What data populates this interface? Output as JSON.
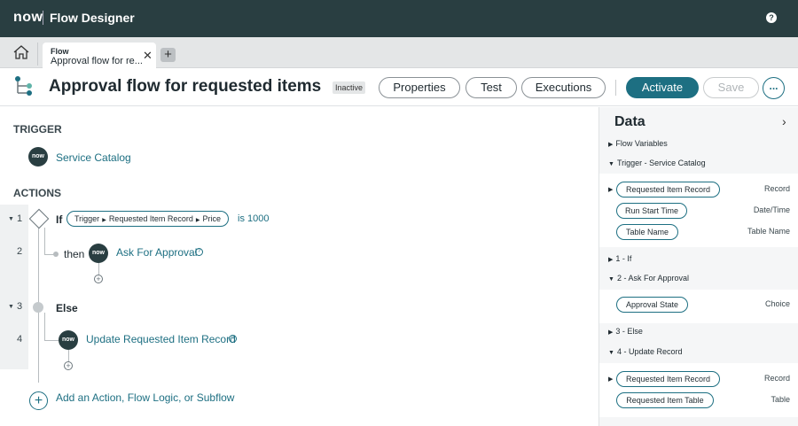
{
  "topbar": {
    "logo": "now",
    "app_title": "Flow Designer",
    "help": "?"
  },
  "tabbar": {
    "tab_type": "Flow",
    "tab_name": "Approval flow for re...",
    "close": "✕",
    "add": "+"
  },
  "header": {
    "title": "Approval flow for requested items",
    "status": "Inactive",
    "properties": "Properties",
    "test": "Test",
    "executions": "Executions",
    "activate": "Activate",
    "save": "Save",
    "more": "..."
  },
  "canvas": {
    "trigger_label": "TRIGGER",
    "trigger_name": "Service Catalog",
    "actions_label": "ACTIONS",
    "badge": "now",
    "steps": [
      {
        "num": "1",
        "keyword": "If",
        "cond_parts": [
          "Trigger",
          "Requested Item Record",
          "Price"
        ],
        "cond_suffix": "is 1000"
      },
      {
        "num": "2",
        "keyword": "then",
        "name": "Ask For Approval"
      },
      {
        "num": "3",
        "keyword": "Else"
      },
      {
        "num": "4",
        "name": "Update Requested Item Record"
      }
    ],
    "add_action": "Add an Action, Flow Logic, or Subflow"
  },
  "panel": {
    "title": "Data",
    "groups": {
      "flow_vars": "Flow Variables",
      "trigger": "Trigger - Service Catalog",
      "if": "1 - If",
      "approval": "2 - Ask For Approval",
      "else": "3 - Else",
      "update": "4 - Update Record"
    },
    "trigger_items": [
      {
        "name": "Requested Item Record",
        "type": "Record"
      },
      {
        "name": "Run Start Time",
        "type": "Date/Time"
      },
      {
        "name": "Table Name",
        "type": "Table Name"
      }
    ],
    "approval_items": [
      {
        "name": "Approval State",
        "type": "Choice"
      }
    ],
    "update_items": [
      {
        "name": "Requested Item Record",
        "type": "Record"
      },
      {
        "name": "Requested Item Table",
        "type": "Table"
      }
    ]
  }
}
